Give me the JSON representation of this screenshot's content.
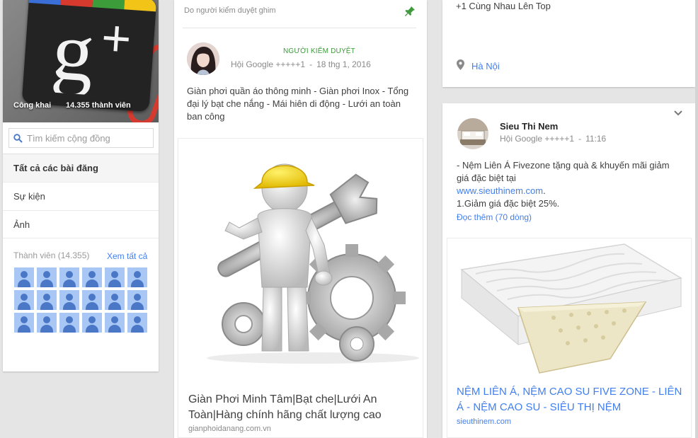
{
  "community": {
    "visibility": "Công khai",
    "member_count_label": "14.355 thành viên"
  },
  "search": {
    "placeholder": "Tìm kiếm cộng đồng"
  },
  "nav": {
    "all_posts": "Tất cả các bài đăng",
    "events": "Sự kiện",
    "photos": "Ảnh"
  },
  "members": {
    "label": "Thành viên (14.355)",
    "see_all": "Xem tất cả",
    "avatars": 18
  },
  "pinned_post": {
    "pinned_note": "Do người kiểm duyệt ghim",
    "role": "NGƯỜI KIỂM DUYỆT",
    "group": "Hội Google +++++1",
    "separator": "-",
    "date": "18 thg 1, 2016",
    "body": "Giàn phơi quần áo thông minh - Giàn phơi Inox - Tổng đại lý bạt che nắng - Mái hiên di động - Lưới an toàn ban công",
    "link_title": "Giàn Phơi Minh Tâm|Bạt che|Lưới An Toàn|Hàng chính hãng chất lượng cao",
    "link_domain": "gianphoidanang.com.vn"
  },
  "top_right_post": {
    "text": "+1 Cùng Nhau Lên Top",
    "location": "Hà Nội"
  },
  "right_post": {
    "author": "Sieu Thi Nem",
    "group": "Hội Google +++++1",
    "separator": "-",
    "time": "11:16",
    "body_line1": "- Nệm Liên Á Fivezone tặng quà & khuyến mãi giảm giá đặc biệt tại",
    "body_link": "www.sieuthinem.com",
    "body_line3": "1.Giảm giá đặc biệt 25%.",
    "read_more": "Đọc thêm (70 dòng)",
    "link_title": "NỆM LIÊN Á, NỆM CAO SU FIVE ZONE - LIÊN Á - NỆM CAO SU - SIÊU THỊ NỆM",
    "link_domain": "sieuthinem.com"
  },
  "colors": {
    "accent_blue": "#427fed",
    "moderator_green": "#3e9a3c",
    "background": "#e5e5e5"
  },
  "icons": [
    "google-plus-logo",
    "search-icon",
    "pin-icon",
    "location-icon",
    "chevron-down-icon",
    "member-avatar-icon"
  ]
}
